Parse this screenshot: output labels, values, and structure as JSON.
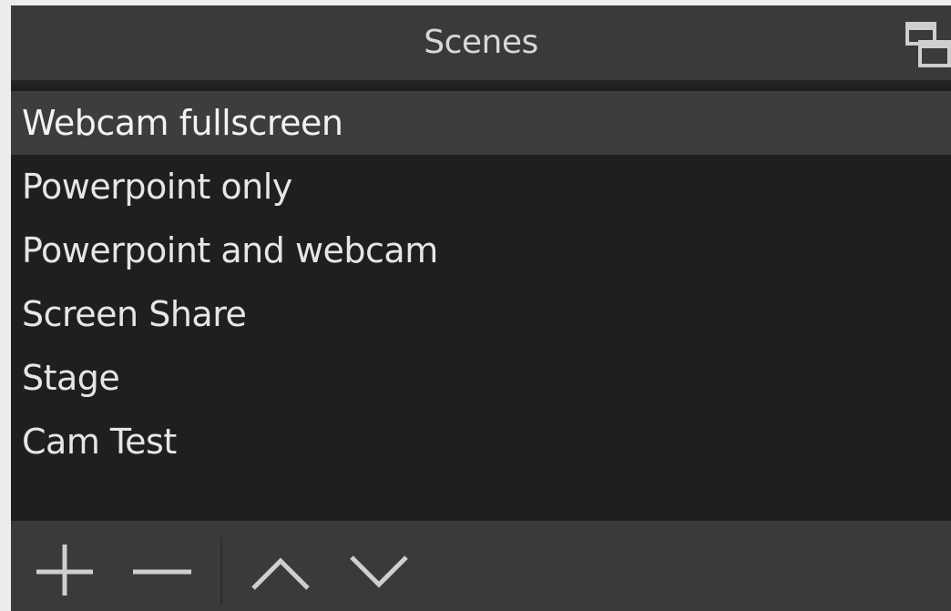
{
  "dock": {
    "title": "Scenes"
  },
  "scenes": [
    {
      "label": "Webcam fullscreen",
      "selected": true
    },
    {
      "label": "Powerpoint only",
      "selected": false
    },
    {
      "label": "Powerpoint and webcam",
      "selected": false
    },
    {
      "label": "Screen Share",
      "selected": false
    },
    {
      "label": "Stage",
      "selected": false
    },
    {
      "label": "Cam Test",
      "selected": false
    }
  ],
  "toolbar": {
    "buttons": [
      "plus-icon",
      "minus-icon",
      "chevron-up-icon",
      "chevron-down-icon"
    ]
  },
  "colors": {
    "panel": "#3a3a3a",
    "list_bg": "#1f1f1f",
    "selected_row": "#3d3d3d",
    "text": "#e6e6e6"
  }
}
